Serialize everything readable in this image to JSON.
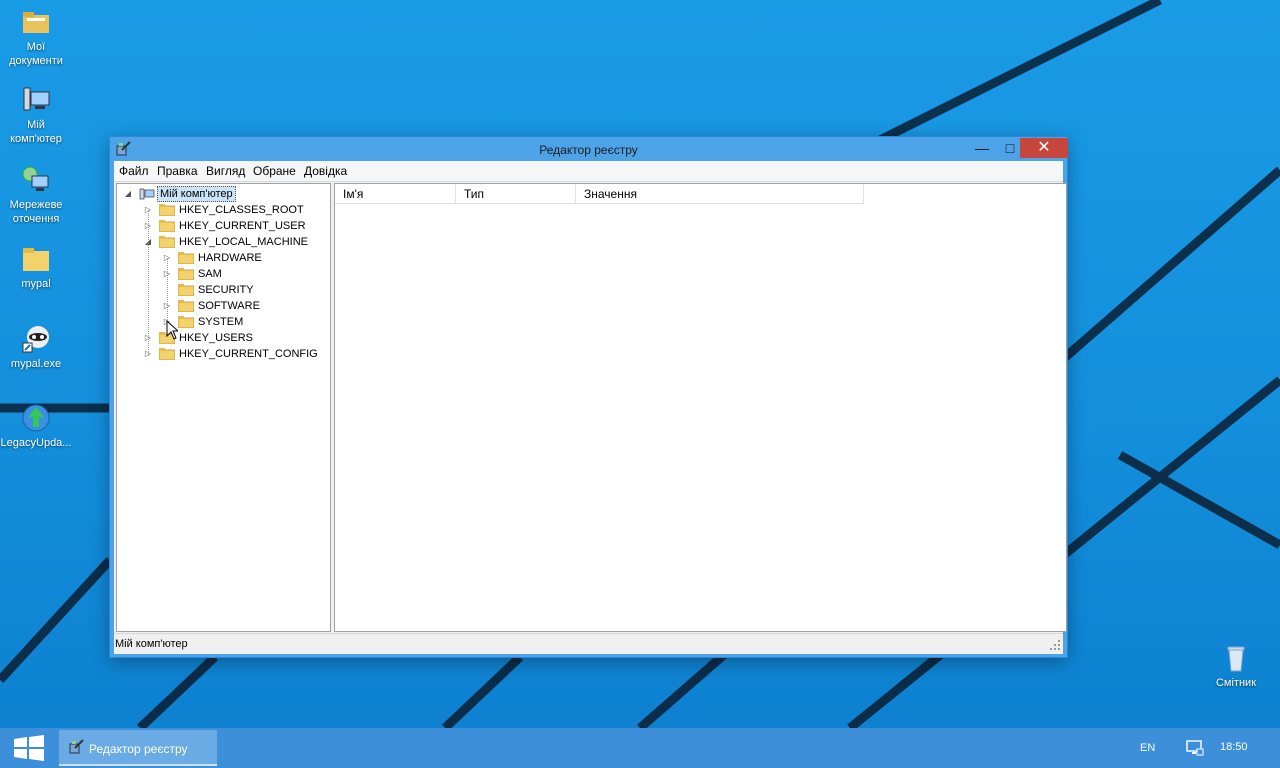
{
  "desktop": {
    "icons": [
      {
        "name": "my-documents",
        "label": "Мої документи"
      },
      {
        "name": "my-computer",
        "label": "Мій комп'ютер"
      },
      {
        "name": "network",
        "label": "Мережеве оточення"
      },
      {
        "name": "mypal-folder",
        "label": "mypal"
      },
      {
        "name": "mypal-exe",
        "label": "mypal.exe"
      },
      {
        "name": "legacy-update",
        "label": "LegacyUpda..."
      },
      {
        "name": "recycle-bin",
        "label": "Смітник"
      }
    ]
  },
  "window": {
    "title": "Редактор реєстру",
    "minimize": "—",
    "maximize": "□",
    "close": "✕",
    "menu": [
      "Файл",
      "Правка",
      "Вигляд",
      "Обране",
      "Довідка"
    ],
    "tree": {
      "root": "Мій комп'ютер",
      "items": [
        {
          "label": "HKEY_CLASSES_ROOT"
        },
        {
          "label": "HKEY_CURRENT_USER"
        },
        {
          "label": "HKEY_LOCAL_MACHINE"
        },
        {
          "label": "HARDWARE"
        },
        {
          "label": "SAM"
        },
        {
          "label": "SECURITY"
        },
        {
          "label": "SOFTWARE"
        },
        {
          "label": "SYSTEM"
        },
        {
          "label": "HKEY_USERS"
        },
        {
          "label": "HKEY_CURRENT_CONFIG"
        }
      ]
    },
    "columns": [
      "Ім'я",
      "Тип",
      "Значення"
    ],
    "status": "Мій комп'ютер"
  },
  "taskbar": {
    "task_label": "Редактор реєстру",
    "language": "EN",
    "time": "18:50"
  },
  "colors": {
    "desktop": "#138fdc",
    "taskbar": "#3d8fd9",
    "window_frame": "#4ca3e8",
    "close_button": "#c7463b",
    "selection": "#cce4f7"
  }
}
